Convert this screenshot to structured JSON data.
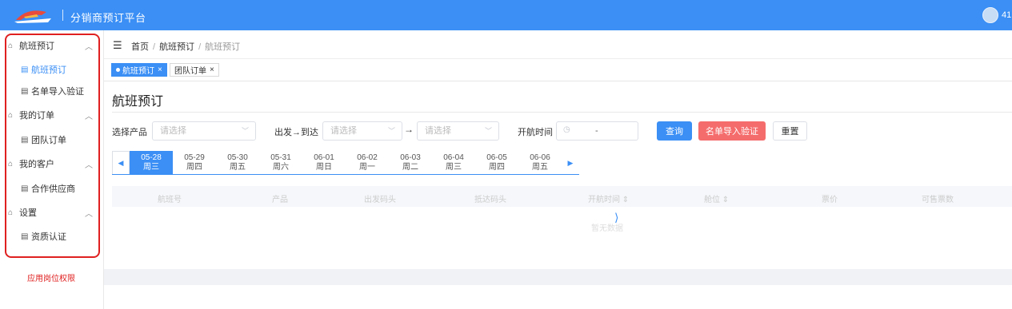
{
  "header": {
    "title": "分销商预订平台",
    "avatar_text": "41",
    "bg_color": "#3b8ff5"
  },
  "sidebar": {
    "groups": [
      {
        "label": "航班预订",
        "icon": "home-icon",
        "items": [
          {
            "label": "航班预订",
            "active": true
          },
          {
            "label": "名单导入验证"
          }
        ]
      },
      {
        "label": "我的订单",
        "icon": "home-icon",
        "items": [
          {
            "label": "团队订单"
          }
        ]
      },
      {
        "label": "我的客户",
        "icon": "home-icon",
        "items": [
          {
            "label": "合作供应商"
          }
        ]
      },
      {
        "label": "设置",
        "icon": "home-icon",
        "items": [
          {
            "label": "资质认证"
          }
        ]
      }
    ],
    "permission_link": "应用岗位权限",
    "highlight_color": "#e02020"
  },
  "breadcrumb": {
    "home": "首页",
    "parent": "航班预订",
    "current": "航班预订",
    "separator": "/"
  },
  "tabs": [
    {
      "label": "航班预订",
      "active": true
    },
    {
      "label": "团队订单",
      "active": false
    }
  ],
  "page": {
    "title": "航班预订"
  },
  "filters": {
    "product_label": "选择产品",
    "product_placeholder": "请选择",
    "route_label": "出发→到达",
    "from_placeholder": "请选择",
    "to_arrow": "→",
    "to_placeholder": "请选择",
    "time_label": "开航时间",
    "time_separator": "-"
  },
  "buttons": {
    "query": "查询",
    "import_verify": "名单导入验证",
    "reset": "重置"
  },
  "dates": [
    {
      "date": "05-28",
      "weekday": "周三",
      "active": true
    },
    {
      "date": "05-29",
      "weekday": "周四"
    },
    {
      "date": "05-30",
      "weekday": "周五"
    },
    {
      "date": "05-31",
      "weekday": "周六"
    },
    {
      "date": "06-01",
      "weekday": "周日"
    },
    {
      "date": "06-02",
      "weekday": "周一"
    },
    {
      "date": "06-03",
      "weekday": "周二"
    },
    {
      "date": "06-04",
      "weekday": "周三"
    },
    {
      "date": "06-05",
      "weekday": "周四"
    },
    {
      "date": "06-06",
      "weekday": "周五"
    }
  ],
  "table": {
    "columns": [
      "航班号",
      "产品",
      "出发码头",
      "抵达码头",
      "开航时间 ⇕",
      "舱位 ⇕",
      "票价",
      "可售票数"
    ],
    "empty_text": "暂无数据"
  }
}
